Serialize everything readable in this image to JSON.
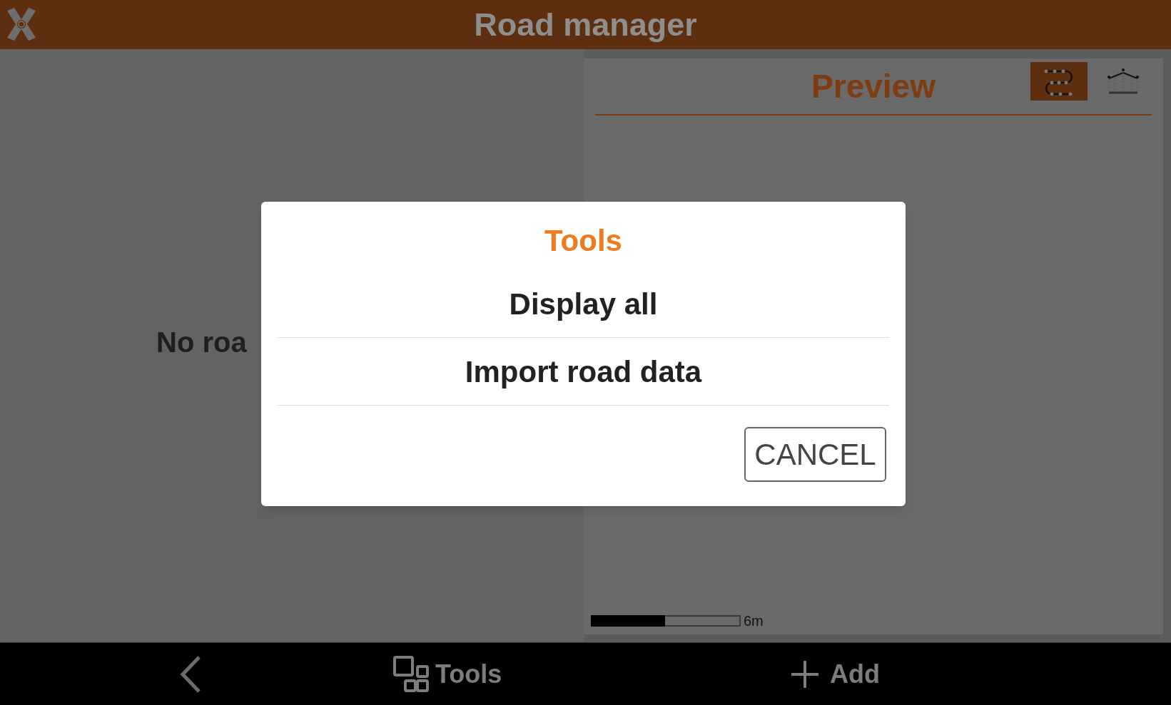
{
  "app_bar": {
    "title": "Road manager"
  },
  "road_list": {
    "empty_message": "No roa"
  },
  "preview": {
    "title": "Preview",
    "view_modes": [
      {
        "kind": "plan",
        "selected": true
      },
      {
        "kind": "cross_section",
        "selected": false
      }
    ],
    "scale_label": "6m"
  },
  "bottom_bar": {
    "tools_label": "Tools",
    "add_label": "Add"
  },
  "dialog": {
    "title": "Tools",
    "items": [
      "Display all",
      "Import road data"
    ],
    "cancel_label": "CANCEL"
  }
}
